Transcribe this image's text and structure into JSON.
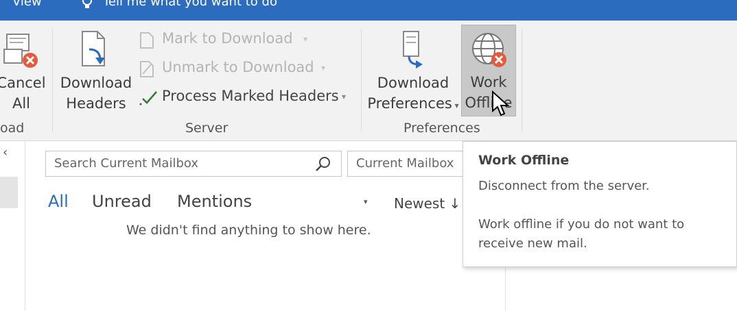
{
  "topbar": {
    "view_label": "View",
    "tell_me": "Tell me what you want to do"
  },
  "ribbon": {
    "cancel_all": {
      "line1": "Cancel",
      "line2": "All"
    },
    "download_headers": {
      "line1": "Download",
      "line2": "Headers"
    },
    "mark_to_download": "Mark to Download",
    "unmark_to_download": "Unmark to Download",
    "process_marked_headers": "Process Marked Headers",
    "download_preferences": {
      "line1": "Download",
      "line2": "Preferences"
    },
    "work_offline": {
      "line1": "Work",
      "line2": "Offline"
    },
    "groups": {
      "download_partial": "oad",
      "server": "Server",
      "preferences": "Preferences"
    }
  },
  "search": {
    "placeholder": "Search Current Mailbox",
    "scope": "Current Mailbox"
  },
  "filters": {
    "all": "All",
    "unread": "Unread",
    "mentions": "Mentions",
    "sort": "Newest"
  },
  "empty_message": "We didn't find anything to show here.",
  "tooltip": {
    "title": "Work Offline",
    "line1": "Disconnect from the server.",
    "line2": "Work offline if you do not want to",
    "line3": "receive new mail."
  },
  "colors": {
    "accent": "#2b6cbf",
    "ribbon_bg": "#f2f2f2",
    "cancel_red": "#e45a3c"
  }
}
